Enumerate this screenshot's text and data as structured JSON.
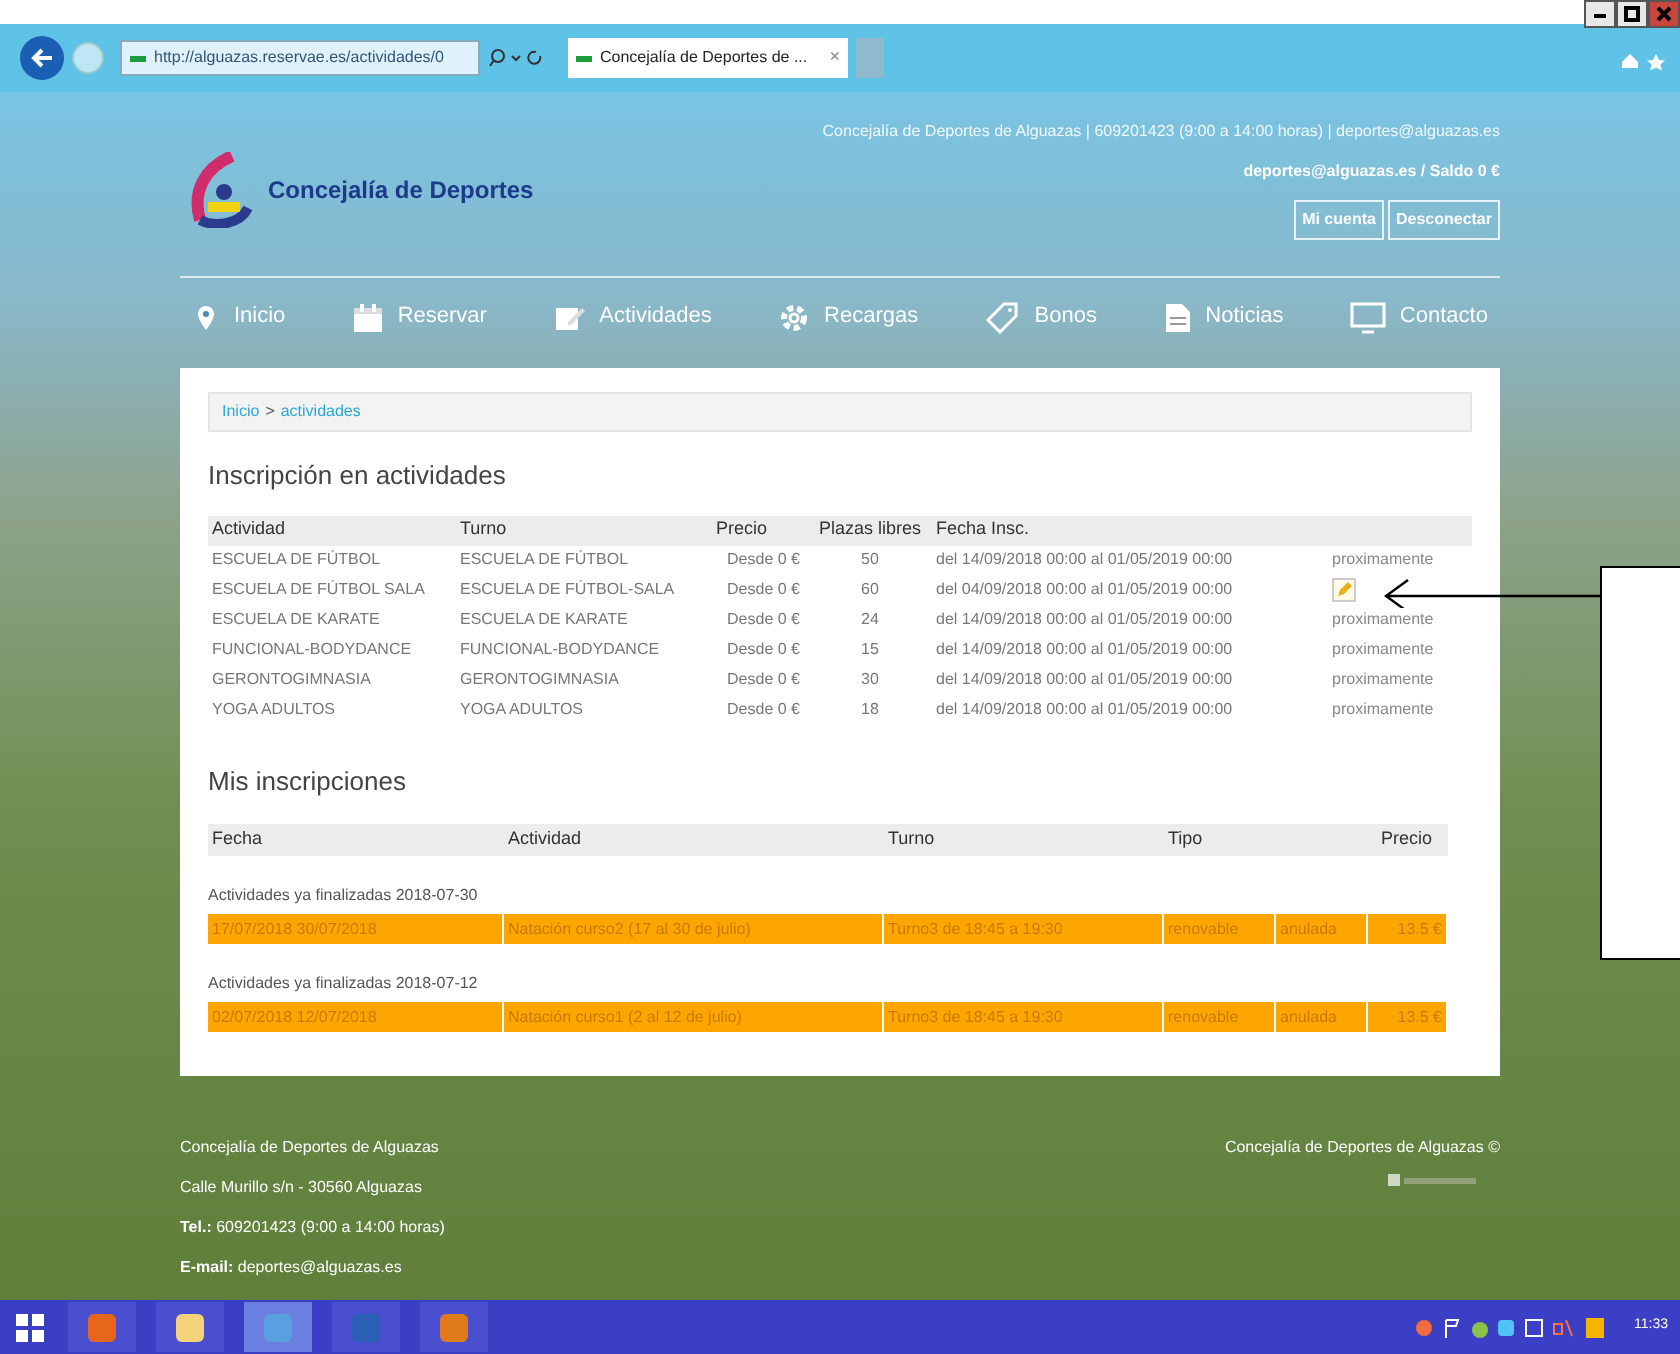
{
  "browser": {
    "url": "http://alguazas.reservae.es/actividades/0",
    "tab_title": "Concejalía de Deportes de ...",
    "tab_close": "×"
  },
  "header": {
    "logo_text": "Concejalía de Deportes",
    "contact_line": "Concejalía de Deportes de Alguazas | 609201423 (9:00 a 14:00 horas) | deportes@alguazas.es",
    "account_line": "deportes@alguazas.es / Saldo 0 €",
    "buttons": [
      "Mi cuenta",
      "Desconectar"
    ]
  },
  "nav": [
    {
      "label": "Inicio",
      "kind": "pin"
    },
    {
      "label": "Reservar",
      "kind": "calendar"
    },
    {
      "label": "Actividades",
      "kind": "edit"
    },
    {
      "label": "Recargas",
      "kind": "gear"
    },
    {
      "label": "Bonos",
      "kind": "tag"
    },
    {
      "label": "Noticias",
      "kind": "doc"
    },
    {
      "label": "Contacto",
      "kind": "monitor"
    }
  ],
  "breadcrumb": [
    {
      "label": "Inicio"
    },
    {
      "label": "actividades"
    }
  ],
  "breadcrumb_sep": ">",
  "activities": {
    "title": "Inscripción en actividades",
    "columns": [
      "Actividad",
      "Turno",
      "Precio",
      "Plazas libres",
      "Fecha Insc."
    ],
    "rows": [
      {
        "actividad": "ESCUELA DE FÚTBOL",
        "turno": "ESCUELA DE FÚTBOL",
        "precio": "Desde 0 €",
        "plazas": "50",
        "fecha": "del 14/09/2018 00:00 al 01/05/2019 00:00",
        "action": {
          "kind": "text",
          "label": "proximamente"
        }
      },
      {
        "actividad": "ESCUELA DE FÚTBOL SALA",
        "turno": "ESCUELA DE FÚTBOL-SALA",
        "precio": "Desde 0 €",
        "plazas": "60",
        "fecha": "del 04/09/2018 00:00 al 01/05/2019 00:00",
        "action": {
          "kind": "edit"
        }
      },
      {
        "actividad": "ESCUELA DE KARATE",
        "turno": "ESCUELA DE KARATE",
        "precio": "Desde 0 €",
        "plazas": "24",
        "fecha": "del 14/09/2018 00:00 al 01/05/2019 00:00",
        "action": {
          "kind": "text",
          "label": "proximamente"
        }
      },
      {
        "actividad": "FUNCIONAL-BODYDANCE",
        "turno": "FUNCIONAL-BODYDANCE",
        "precio": "Desde 0 €",
        "plazas": "15",
        "fecha": "del 14/09/2018 00:00 al 01/05/2019 00:00",
        "action": {
          "kind": "text",
          "label": "proximamente"
        }
      },
      {
        "actividad": "GERONTOGIMNASIA",
        "turno": "GERONTOGIMNASIA",
        "precio": "Desde 0 €",
        "plazas": "30",
        "fecha": "del 14/09/2018 00:00 al 01/05/2019 00:00",
        "action": {
          "kind": "text",
          "label": "proximamente"
        }
      },
      {
        "actividad": "YOGA ADULTOS",
        "turno": "YOGA ADULTOS",
        "precio": "Desde 0 €",
        "plazas": "18",
        "fecha": "del 14/09/2018 00:00 al 01/05/2019 00:00",
        "action": {
          "kind": "text",
          "label": "proximamente"
        }
      }
    ]
  },
  "inscriptions": {
    "title": "Mis inscripciones",
    "columns": [
      "Fecha",
      "Actividad",
      "Turno",
      "Tipo",
      "Precio"
    ],
    "groups": [
      {
        "heading": "Actividades ya finalizadas 2018-07-30",
        "row": [
          "17/07/2018 30/07/2018",
          "Natación curso2 (17 al 30 de julio)",
          "Turno3 de 18:45 a 19:30",
          "renovable",
          "anulada",
          "13.5 €"
        ]
      },
      {
        "heading": "Actividades ya finalizadas 2018-07-12",
        "row": [
          "02/07/2018 12/07/2018",
          "Natación curso1 (2 al 12 de julio)",
          "Turno3 de 18:45 a 19:30",
          "renovable",
          "anulada",
          "13.5 €"
        ]
      }
    ]
  },
  "footer": {
    "lines": [
      {
        "text": "Concejalía de Deportes de Alguazas"
      },
      {
        "text": "Calle Murillo s/n - 30560 Alguazas"
      },
      {
        "label": "Tel.:",
        "text": "609201423 (9:00 a 14:00 horas)"
      },
      {
        "label": "E-mail:",
        "text": "deportes@alguazas.es"
      }
    ],
    "copyright": "Concejalía de Deportes de Alguazas ©"
  },
  "taskbar": {
    "clock": "11:33"
  }
}
